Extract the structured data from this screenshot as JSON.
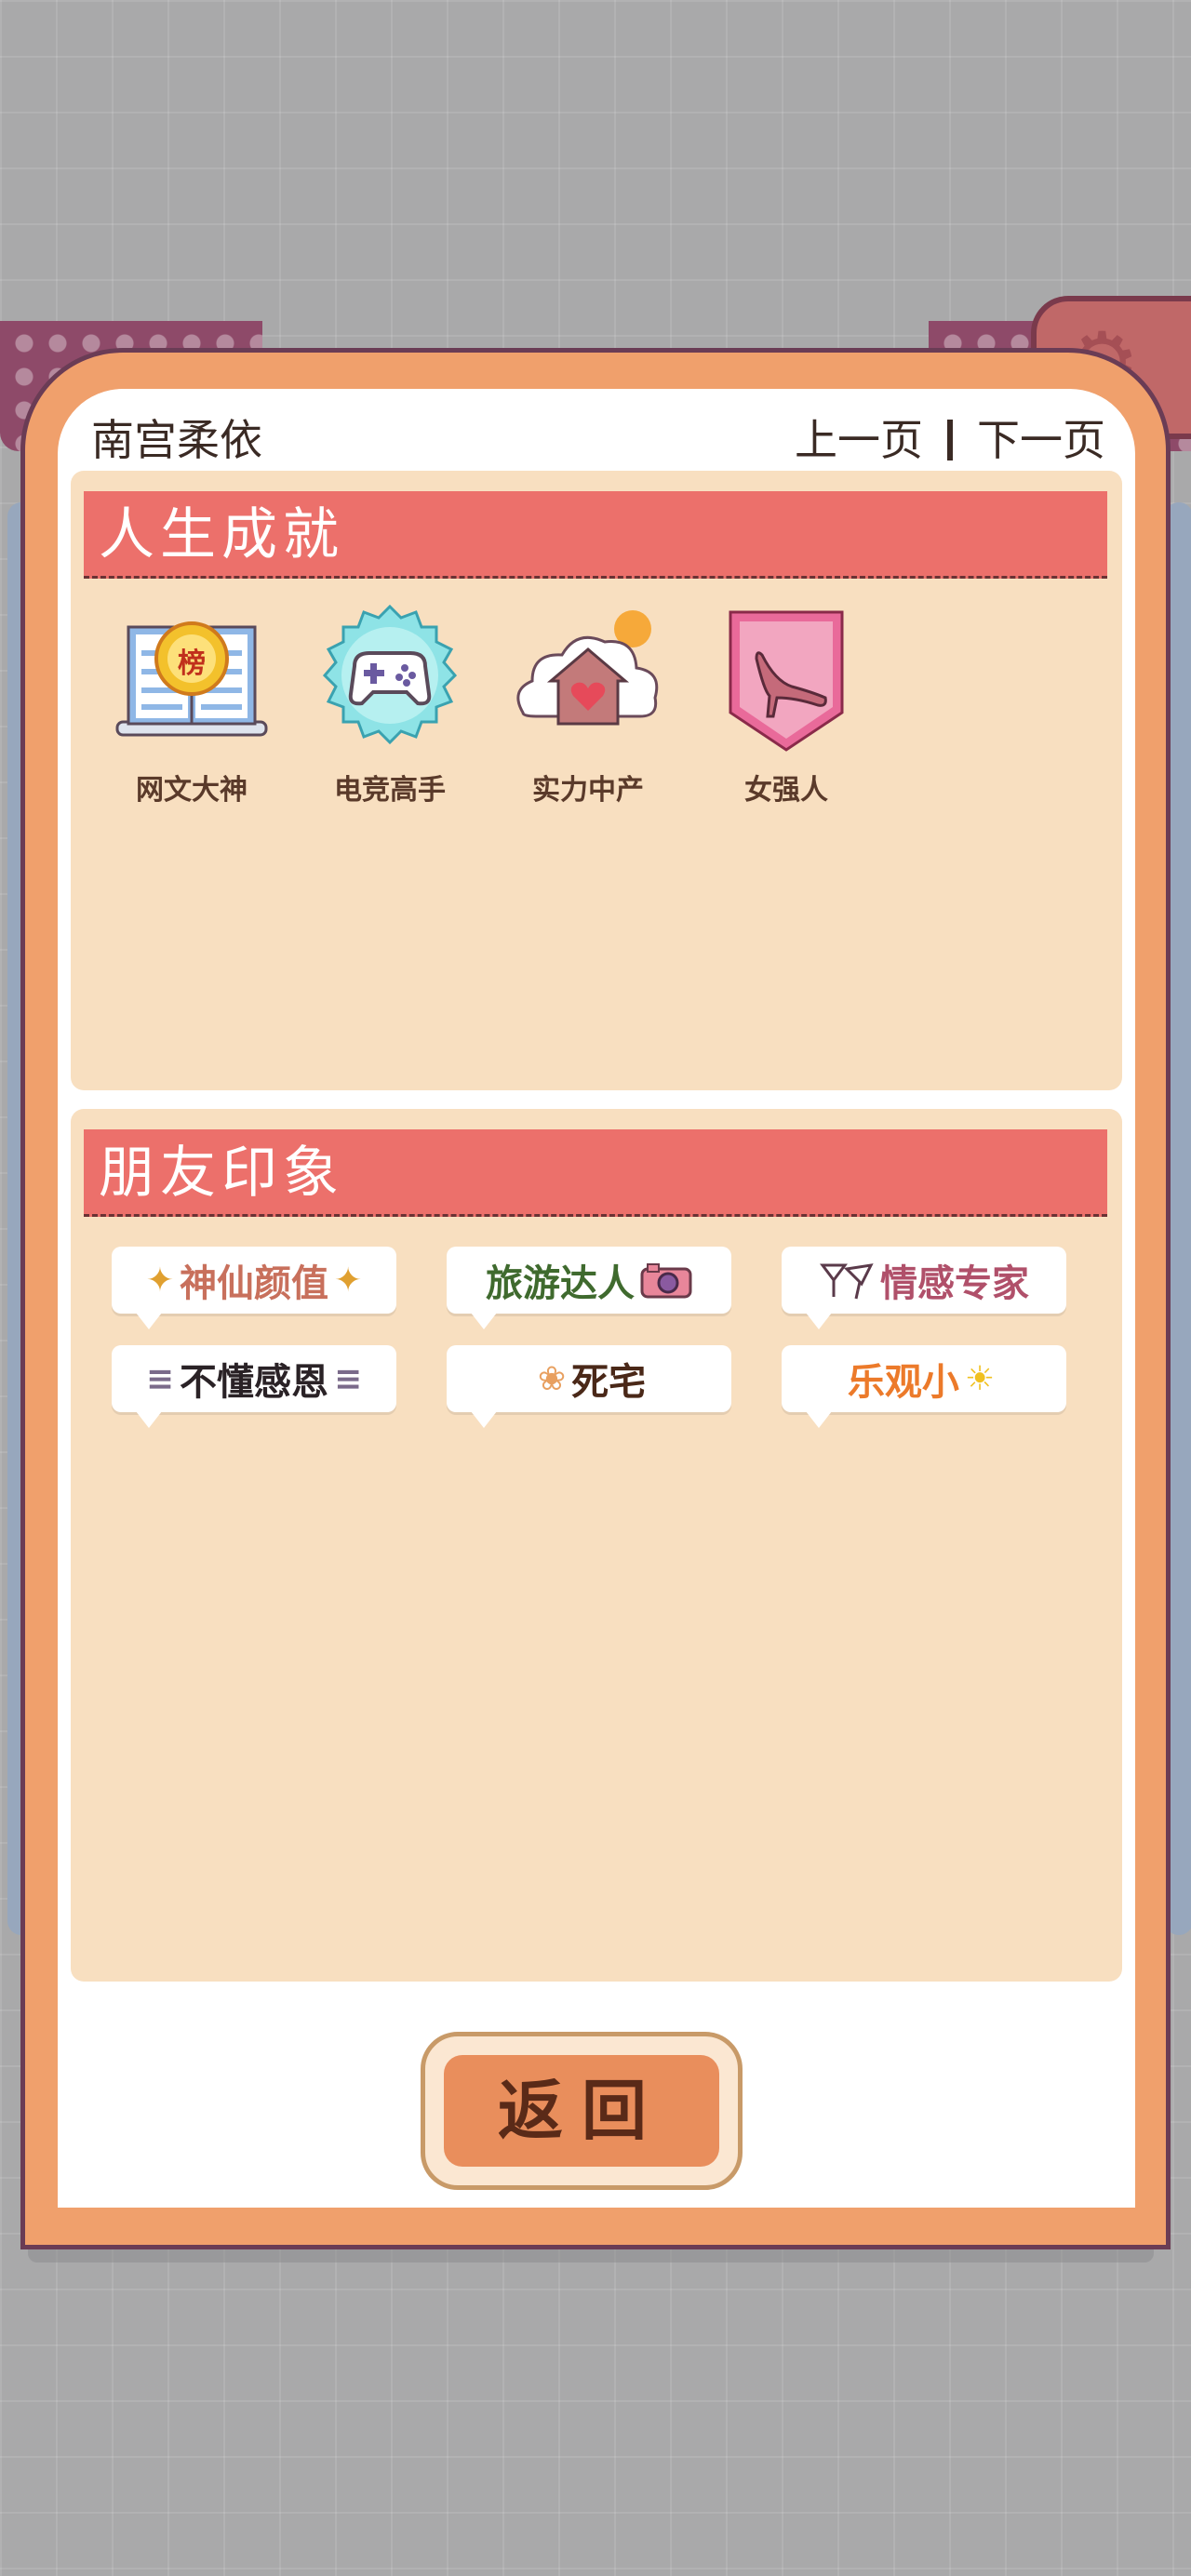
{
  "header": {
    "character_name": "南宫柔依",
    "prev_label": "上一页",
    "next_label": "下一页"
  },
  "achievements": {
    "title": "人生成就",
    "items": [
      {
        "label": "网文大神",
        "icon": "book-ranking-icon",
        "badge_text": "榜"
      },
      {
        "label": "电竞高手",
        "icon": "gamepad-icon"
      },
      {
        "label": "实力中产",
        "icon": "house-heart-icon"
      },
      {
        "label": "女强人",
        "icon": "high-heel-icon"
      }
    ]
  },
  "impressions": {
    "title": "朋友印象",
    "tags": [
      {
        "text": "神仙颜值",
        "icon": "sparkle-icon",
        "color": "#c8705c"
      },
      {
        "text": "旅游达人",
        "icon": "camera-icon",
        "color": "#3f6a2e"
      },
      {
        "text": "情感专家",
        "icon": "cocktail-icon",
        "color": "#b0506a"
      },
      {
        "text": "不懂感恩",
        "icon": "dash-icon",
        "color": "#2a2226"
      },
      {
        "text": "死宅",
        "icon": "paw-icon",
        "color": "#4a2818"
      },
      {
        "text": "乐观小",
        "icon": "sun-icon",
        "color": "#ec7a2a"
      }
    ]
  },
  "footer": {
    "return_label": "返回"
  },
  "colors": {
    "modal_frame": "#f0a06c",
    "section_bg": "#f8dfc0",
    "section_title_bg": "#ec706b"
  }
}
